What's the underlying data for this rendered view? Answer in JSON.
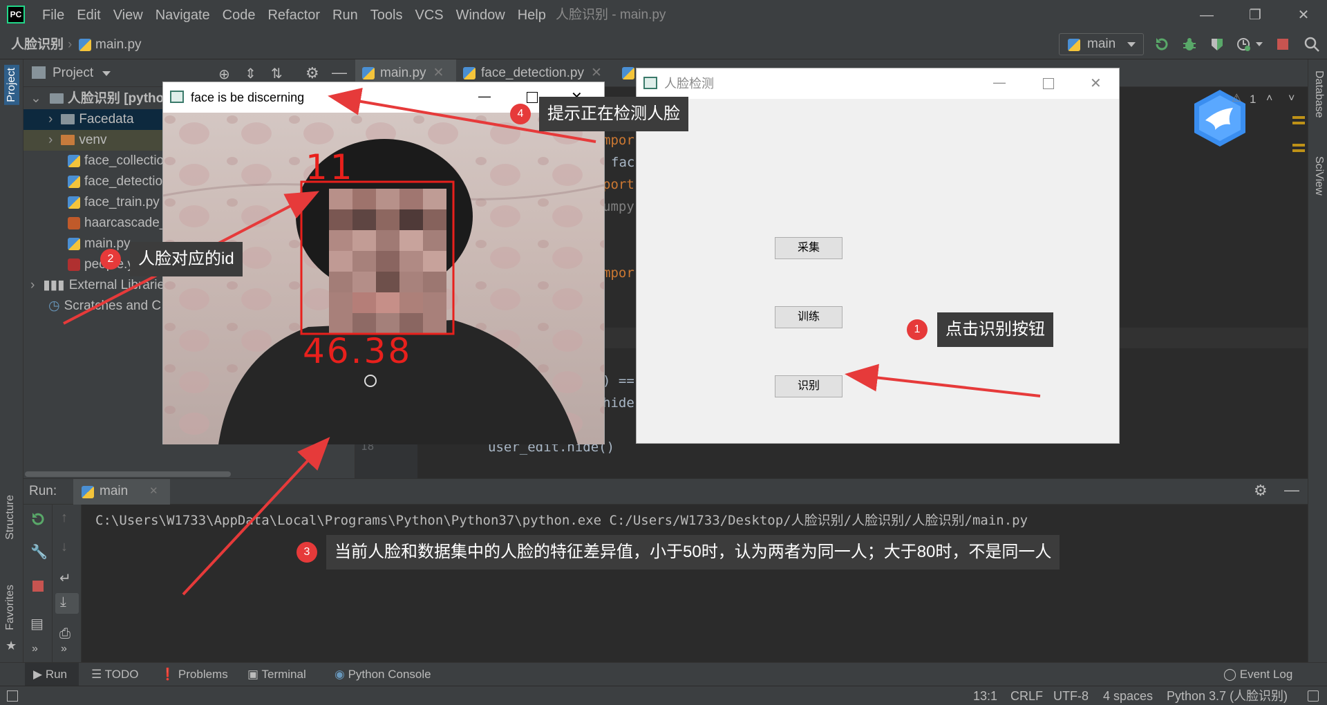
{
  "window": {
    "title": "人脸识别 - main.py",
    "logo": "PC",
    "min_icon": "minimize-icon",
    "restore_icon": "restore-icon",
    "close_icon": "close-icon"
  },
  "menu": {
    "items": [
      "File",
      "Edit",
      "View",
      "Navigate",
      "Code",
      "Refactor",
      "Run",
      "Tools",
      "VCS",
      "Window",
      "Help"
    ]
  },
  "navbar": {
    "project": "人脸识别",
    "file": "main.py",
    "run_config": "main"
  },
  "left_strip": {
    "project": "Project",
    "structure": "Structure",
    "favorites": "Favorites"
  },
  "right_strip": {
    "database": "Database",
    "sciview": "SciView"
  },
  "project_pane": {
    "title": "Project",
    "tree": [
      {
        "label": "人脸识别 [pytho",
        "indent": 0,
        "kind": "folder"
      },
      {
        "label": "Facedata",
        "indent": 1,
        "kind": "folder"
      },
      {
        "label": "venv",
        "indent": 1,
        "kind": "folder-orange"
      },
      {
        "label": "face_collectio",
        "indent": 1,
        "kind": "py"
      },
      {
        "label": "face_detectio",
        "indent": 1,
        "kind": "py"
      },
      {
        "label": "face_train.py",
        "indent": 1,
        "kind": "py"
      },
      {
        "label": "haarcascade_",
        "indent": 1,
        "kind": "xml"
      },
      {
        "label": "main.py",
        "indent": 1,
        "kind": "py"
      },
      {
        "label": "people.yml",
        "indent": 1,
        "kind": "yml"
      },
      {
        "label": "External Librarie",
        "indent": 0,
        "kind": "lib"
      },
      {
        "label": "Scratches and C",
        "indent": 0,
        "kind": "scratch"
      }
    ]
  },
  "editor": {
    "tabs": [
      "main.py",
      "face_detection.py"
    ],
    "inspection_count": "1",
    "code_fragments": {
      "l1": "mpor",
      "l2": "fac",
      "l3": "port",
      "l4": "umpy",
      "l5": "mpor",
      "l6": ") ==",
      "l7": "hide",
      "l8_num": "18",
      "l8": "user_edit.hide()"
    }
  },
  "run_panel": {
    "label": "Run:",
    "tab": "main",
    "command": "C:\\Users\\W1733\\AppData\\Local\\Programs\\Python\\Python37\\python.exe C:/Users/W1733/Desktop/人脸识别/人脸识别/人脸识别/main.py"
  },
  "tool_tabs": [
    "Run",
    "TODO",
    "Problems",
    "Terminal",
    "Python Console",
    "Event Log"
  ],
  "status": {
    "position": "13:1",
    "line_sep": "CRLF",
    "encoding": "UTF-8",
    "indent": "4 spaces",
    "interpreter": "Python 3.7 (人脸识别)"
  },
  "face_window": {
    "title": "face is be discerning",
    "id_label": "11",
    "confidence": "46.38"
  },
  "dialog": {
    "title": "人脸检测",
    "buttons": [
      "采集",
      "训练",
      "识别"
    ]
  },
  "callouts": [
    {
      "num": "1",
      "text": "点击识别按钮"
    },
    {
      "num": "2",
      "text": "人脸对应的id"
    },
    {
      "num": "3",
      "text": "当前人脸和数据集中的人脸的特征差异值，小于50时，认为两者为同一人；大于80时，不是同一人"
    },
    {
      "num": "4",
      "text": "提示正在检测人脸"
    }
  ],
  "colors": {
    "accent": "#e63a3a",
    "face_box": "#e8201c",
    "ide_bg": "#2b2b2b",
    "panel_bg": "#3c3f41"
  }
}
